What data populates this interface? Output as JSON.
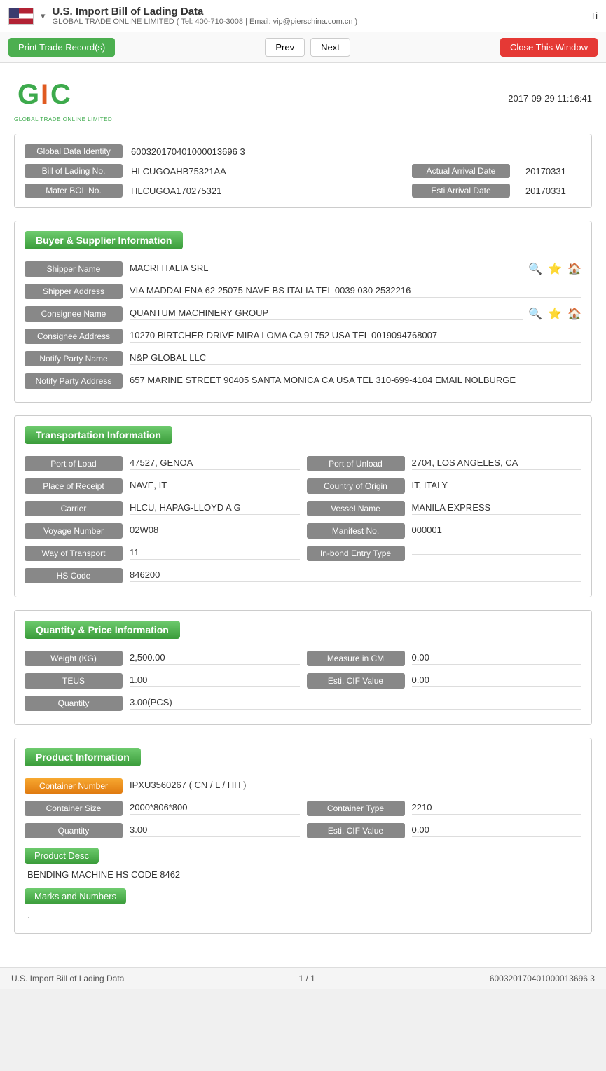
{
  "header": {
    "title": "U.S. Import Bill of Lading Data",
    "dropdown_arrow": "▾",
    "subtitle": "GLOBAL TRADE ONLINE LIMITED ( Tel: 400-710-3008 | Email: vip@pierschina.com.cn )",
    "tab_label": "Ti"
  },
  "toolbar": {
    "print_label": "Print Trade Record(s)",
    "prev_label": "Prev",
    "next_label": "Next",
    "close_label": "Close This Window"
  },
  "logo": {
    "company_name": "GLOBAL TRADE ONLINE LIMITED",
    "timestamp": "2017-09-29 11:16:41"
  },
  "identity": {
    "global_data_identity_label": "Global Data Identity",
    "global_data_identity_value": "600320170401000013696 3",
    "bill_of_lading_label": "Bill of Lading No.",
    "bill_of_lading_value": "HLCUGOAHB75321AA",
    "actual_arrival_label": "Actual Arrival Date",
    "actual_arrival_value": "20170331",
    "mater_bol_label": "Mater BOL No.",
    "mater_bol_value": "HLCUGOA170275321",
    "esti_arrival_label": "Esti Arrival Date",
    "esti_arrival_value": "20170331"
  },
  "buyer_supplier": {
    "section_title": "Buyer & Supplier Information",
    "shipper_name_label": "Shipper Name",
    "shipper_name_value": "MACRI ITALIA SRL",
    "shipper_address_label": "Shipper Address",
    "shipper_address_value": "VIA MADDALENA 62 25075 NAVE BS ITALIA TEL 0039 030 2532216",
    "consignee_name_label": "Consignee Name",
    "consignee_name_value": "QUANTUM MACHINERY GROUP",
    "consignee_address_label": "Consignee Address",
    "consignee_address_value": "10270 BIRTCHER DRIVE MIRA LOMA CA 91752 USA TEL 0019094768007",
    "notify_party_name_label": "Notify Party Name",
    "notify_party_name_value": "N&P GLOBAL LLC",
    "notify_party_address_label": "Notify Party Address",
    "notify_party_address_value": "657 MARINE STREET 90405 SANTA MONICA CA USA TEL 310-699-4104 EMAIL NOLBURGE"
  },
  "transportation": {
    "section_title": "Transportation Information",
    "port_of_load_label": "Port of Load",
    "port_of_load_value": "47527, GENOA",
    "port_of_unload_label": "Port of Unload",
    "port_of_unload_value": "2704, LOS ANGELES, CA",
    "place_of_receipt_label": "Place of Receipt",
    "place_of_receipt_value": "NAVE, IT",
    "country_of_origin_label": "Country of Origin",
    "country_of_origin_value": "IT, ITALY",
    "carrier_label": "Carrier",
    "carrier_value": "HLCU, HAPAG-LLOYD A G",
    "vessel_name_label": "Vessel Name",
    "vessel_name_value": "MANILA EXPRESS",
    "voyage_number_label": "Voyage Number",
    "voyage_number_value": "02W08",
    "manifest_no_label": "Manifest No.",
    "manifest_no_value": "000001",
    "way_of_transport_label": "Way of Transport",
    "way_of_transport_value": "11",
    "in_bond_entry_label": "In-bond Entry Type",
    "in_bond_entry_value": "",
    "hs_code_label": "HS Code",
    "hs_code_value": "846200"
  },
  "quantity_price": {
    "section_title": "Quantity & Price Information",
    "weight_label": "Weight (KG)",
    "weight_value": "2,500.00",
    "measure_cm_label": "Measure in CM",
    "measure_cm_value": "0.00",
    "teus_label": "TEUS",
    "teus_value": "1.00",
    "esti_cif_label": "Esti. CIF Value",
    "esti_cif_value": "0.00",
    "quantity_label": "Quantity",
    "quantity_value": "3.00(PCS)"
  },
  "product_information": {
    "section_title": "Product Information",
    "container_number_label": "Container Number",
    "container_number_value": "IPXU3560267 ( CN / L / HH )",
    "container_size_label": "Container Size",
    "container_size_value": "2000*806*800",
    "container_type_label": "Container Type",
    "container_type_value": "2210",
    "quantity_label": "Quantity",
    "quantity_value": "3.00",
    "esti_cif_label": "Esti. CIF Value",
    "esti_cif_value": "0.00",
    "product_desc_btn": "Product Desc",
    "product_desc_text": "BENDING MACHINE HS CODE 8462",
    "marks_btn": "Marks and Numbers",
    "marks_text": "."
  },
  "footer": {
    "left": "U.S. Import Bill of Lading Data",
    "center": "1 / 1",
    "right": "600320170401000013696 3"
  }
}
